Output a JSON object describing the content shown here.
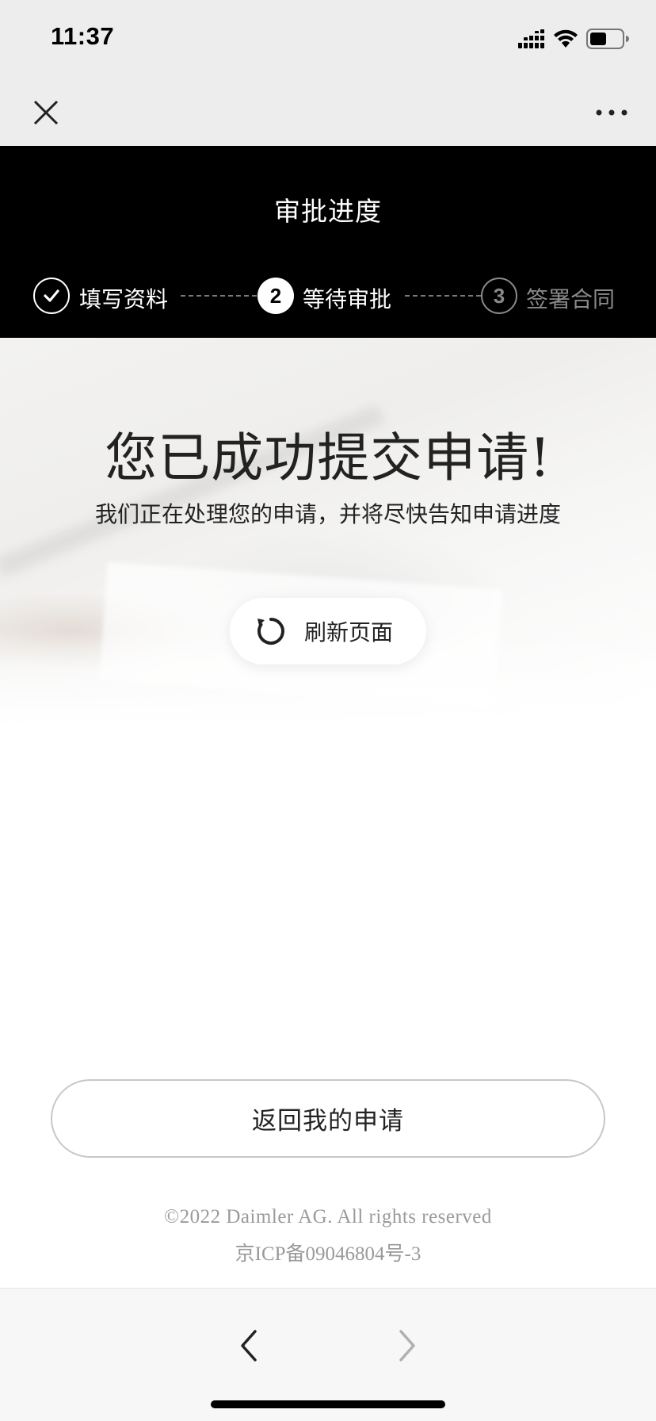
{
  "status_bar": {
    "time": "11:37"
  },
  "icons": {
    "close": "close-icon",
    "more": "more-icon",
    "step1": "check-icon",
    "refresh": "refresh-icon",
    "back": "chevron-left-icon",
    "forward": "chevron-right-icon"
  },
  "header": {
    "title": "审批进度"
  },
  "steps": [
    {
      "label": "填写资料",
      "status": "done"
    },
    {
      "number": "2",
      "label": "等待审批",
      "status": "active"
    },
    {
      "number": "3",
      "label": "签署合同",
      "status": "pending"
    }
  ],
  "hero": {
    "title": "您已成功提交申请!",
    "subtitle": "我们正在处理您的申请，并将尽快告知申请进度"
  },
  "refresh_button": {
    "label": "刷新页面"
  },
  "back_button": {
    "label": "返回我的申请"
  },
  "footer": {
    "copyright": "©2022 Daimler AG. All rights reserved",
    "icp": "京ICP备09046804号-3"
  },
  "colors": {
    "header_bg": "#000000",
    "chrome_bg": "#ededed",
    "active_text": "#ffffff",
    "pending_text": "#8a8a8a",
    "footer_text": "#9a9a9a"
  }
}
